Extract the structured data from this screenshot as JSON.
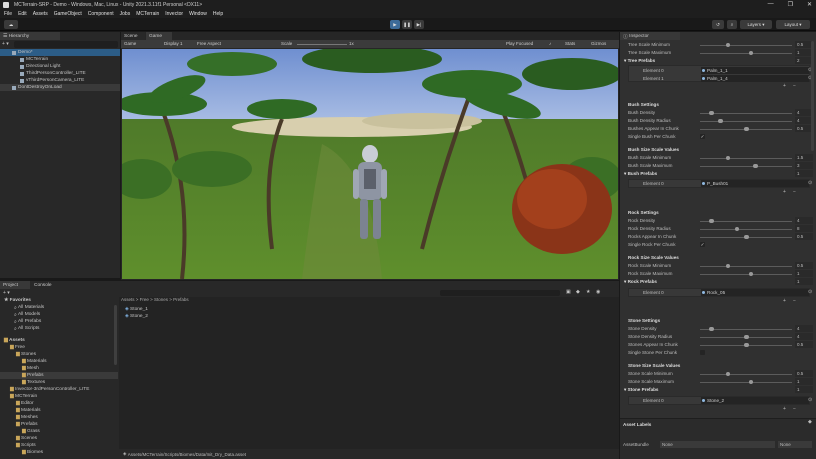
{
  "window": {
    "title": "MCTerrain-SRP - Demo - Windows, Mac, Linux - Unity 2021.3.11f1 Personal <DX11>",
    "controls": [
      "—",
      "❐",
      "✕"
    ]
  },
  "menu": [
    "File",
    "Edit",
    "Assets",
    "GameObject",
    "Component",
    "Jobs",
    "MCTerrain",
    "Invector",
    "Window",
    "Help"
  ],
  "toolbar": {
    "layers": "Layers",
    "layout": "Layout"
  },
  "hierarchy": {
    "tab": "Hierarchy",
    "add": "+ ▾",
    "items": [
      {
        "label": "Demo*",
        "indent": 0
      },
      {
        "label": "MCTerrain",
        "indent": 1
      },
      {
        "label": "Directional Light",
        "indent": 1
      },
      {
        "label": "ThirdPersonController_LITE",
        "indent": 1
      },
      {
        "label": "vThirdPersonCamera_LITE",
        "indent": 1
      },
      {
        "label": "DontDestroyOnLoad",
        "indent": 0
      }
    ]
  },
  "scene": {
    "tabs": [
      "Scene",
      "Game"
    ],
    "game_label": "Game",
    "display": "Display 1",
    "aspect": "Free Aspect",
    "scale_label": "Scale",
    "scale_value": "1x",
    "play_focused": "Play Focused",
    "stats": "Stats",
    "gizmos": "Gizmos"
  },
  "project": {
    "tabs": [
      "Project",
      "Console"
    ],
    "add": "+ ▾",
    "breadcrumb": "Assets > Free > Stones > Prefabs",
    "files": [
      "Stone_1",
      "Stone_2"
    ],
    "path": "Assets/MCTerrain/Scripts/Biomes/Data/Init_Dry_Data.asset",
    "tree": [
      {
        "label": "Favorites",
        "indent": 0,
        "bold": true
      },
      {
        "label": "All Materials",
        "indent": 1
      },
      {
        "label": "All Models",
        "indent": 1
      },
      {
        "label": "All Prefabs",
        "indent": 1
      },
      {
        "label": "All Scripts",
        "indent": 1
      },
      {
        "label": "Assets",
        "indent": 0,
        "bold": true
      },
      {
        "label": "Free",
        "indent": 1
      },
      {
        "label": "Stones",
        "indent": 2
      },
      {
        "label": "Materials",
        "indent": 3
      },
      {
        "label": "Mesh",
        "indent": 3
      },
      {
        "label": "Prefabs",
        "indent": 3
      },
      {
        "label": "Textures",
        "indent": 3
      },
      {
        "label": "Invector-3rdPersonController_LITE",
        "indent": 1
      },
      {
        "label": "MCTerrain",
        "indent": 1
      },
      {
        "label": "Editor",
        "indent": 2
      },
      {
        "label": "Materials",
        "indent": 2
      },
      {
        "label": "Meshes",
        "indent": 2
      },
      {
        "label": "Prefabs",
        "indent": 2
      },
      {
        "label": "Grass",
        "indent": 3
      },
      {
        "label": "Scenes",
        "indent": 2
      },
      {
        "label": "Scripts",
        "indent": 2
      },
      {
        "label": "Biomes",
        "indent": 3
      }
    ]
  },
  "inspector": {
    "tab": "Inspector",
    "tree_scale_min": {
      "label": "Tree Scale Minimum",
      "value": "0.5",
      "level": 0.3
    },
    "tree_scale_max": {
      "label": "Tree Scale Maximum",
      "value": "1",
      "level": 0.55
    },
    "tree_prefabs": {
      "label": "Tree Prefabs",
      "count": "2",
      "elements": [
        {
          "label": "Element 0",
          "value": "Palm_1_1"
        },
        {
          "label": "Element 1",
          "value": "Palm_1_4"
        }
      ]
    },
    "bush_settings": {
      "label": "Bush Settings"
    },
    "bush_density": {
      "label": "Bush Density",
      "value": "4",
      "level": 0.12
    },
    "bush_density_radius": {
      "label": "Bush Density Radius",
      "value": "4",
      "level": 0.22
    },
    "bushes_appear": {
      "label": "Bushes Appear In Chunk",
      "value": "0.5",
      "level": 0.5
    },
    "single_bush": {
      "label": "Single Bush Per Chunk",
      "checked": "✓"
    },
    "bush_size": {
      "label": "Bush Size Scale Values"
    },
    "bush_scale_min": {
      "label": "Bush Scale Minimum",
      "value": "1.5",
      "level": 0.3
    },
    "bush_scale_max": {
      "label": "Bush Scale Maximum",
      "value": "3",
      "level": 0.6
    },
    "bush_prefabs": {
      "label": "Bush Prefabs",
      "count": "1",
      "elements": [
        {
          "label": "Element 0",
          "value": "P_Bush01"
        }
      ]
    },
    "rock_settings": {
      "label": "Rock Settings"
    },
    "rock_density": {
      "label": "Rock Density",
      "value": "4",
      "level": 0.12
    },
    "rock_density_radius": {
      "label": "Rock Density Radius",
      "value": "8",
      "level": 0.4
    },
    "rocks_appear": {
      "label": "Rocks Appear In Chunk",
      "value": "0.5",
      "level": 0.5
    },
    "single_rock": {
      "label": "Single Rock Per Chunk",
      "checked": "✓"
    },
    "rock_size": {
      "label": "Rock Size Scale Values"
    },
    "rock_scale_min": {
      "label": "Rock Scale Minimum",
      "value": "0.5",
      "level": 0.3
    },
    "rock_scale_max": {
      "label": "Rock Scale Maximum",
      "value": "1",
      "level": 0.55
    },
    "rock_prefabs": {
      "label": "Rock Prefabs",
      "count": "1",
      "elements": [
        {
          "label": "Element 0",
          "value": "Rock_05"
        }
      ]
    },
    "stone_settings": {
      "label": "Stone Settings"
    },
    "stone_density": {
      "label": "Stone Density",
      "value": "4",
      "level": 0.12
    },
    "stone_density_radius": {
      "label": "Stone Density Radius",
      "value": "4",
      "level": 0.5
    },
    "stones_appear": {
      "label": "Stones Appear In Chunk",
      "value": "0.5",
      "level": 0.5
    },
    "single_stone": {
      "label": "Single Stone Per Chunk",
      "checked": ""
    },
    "stone_size": {
      "label": "Stone Size Scale Values"
    },
    "stone_scale_min": {
      "label": "Stone Scale Minimum",
      "value": "0.5",
      "level": 0.3
    },
    "stone_scale_max": {
      "label": "Stone Scale Maximum",
      "value": "1",
      "level": 0.55
    },
    "stone_prefabs": {
      "label": "Stone Prefabs",
      "count": "1",
      "elements": [
        {
          "label": "Element 0",
          "value": "Stone_2"
        }
      ]
    },
    "asset_labels": "Asset Labels",
    "asset_bundle": {
      "label": "AssetBundle",
      "value": "None",
      "variant": "None"
    }
  }
}
